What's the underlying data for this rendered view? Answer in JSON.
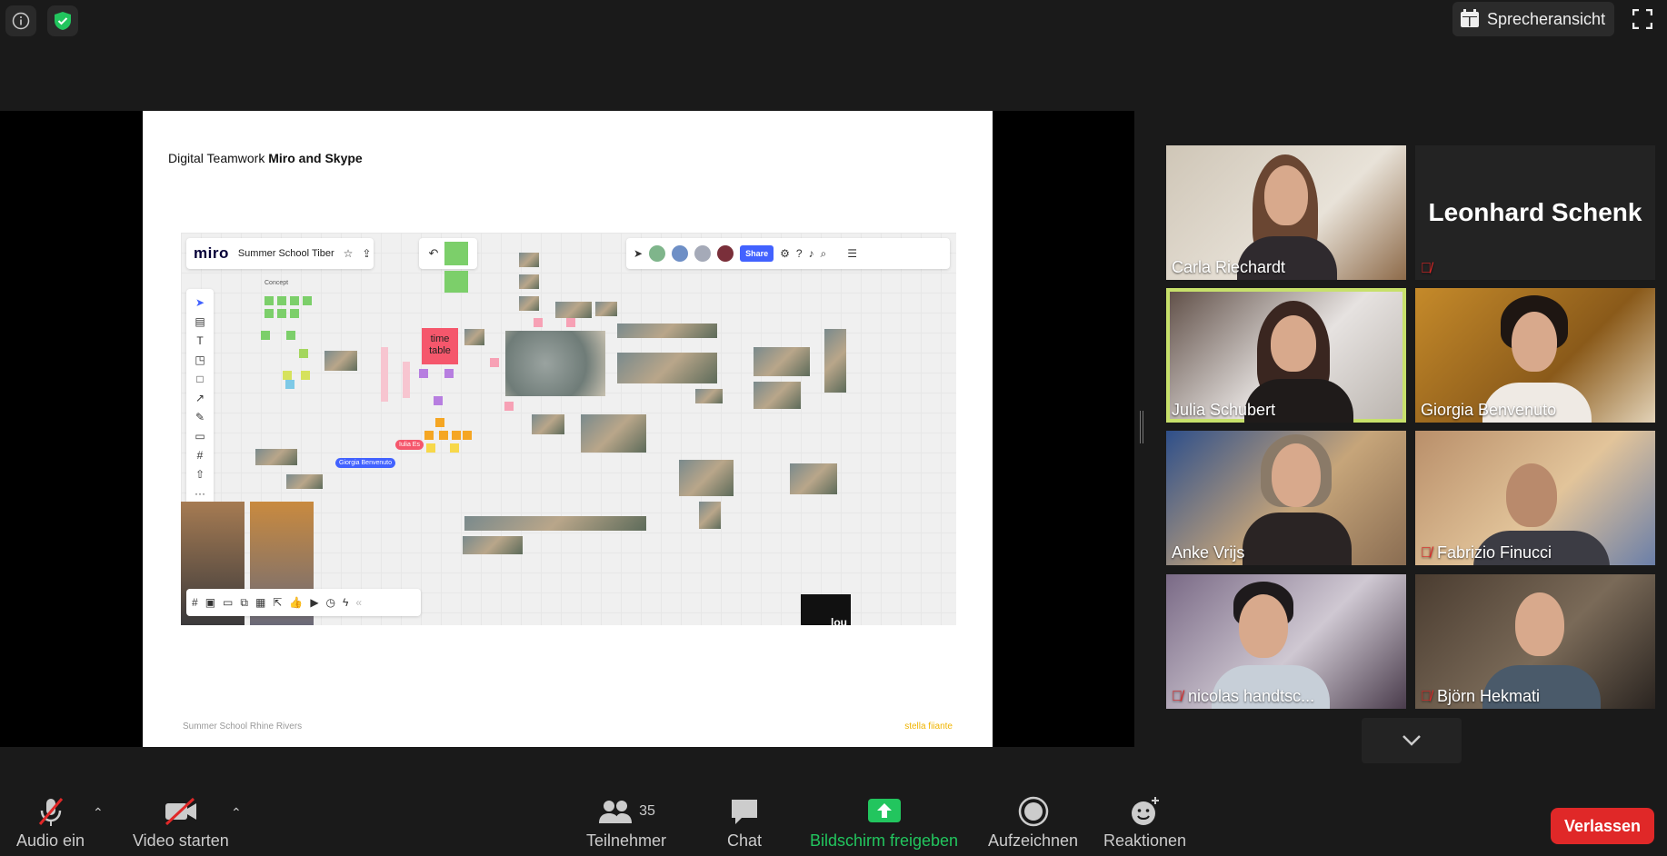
{
  "top": {
    "speaker_view_label": "Sprecheransicht"
  },
  "slide": {
    "title_prefix": "Digital Teamwork",
    "title_bold": "Miro and Skype",
    "footer_left": "Summer School Rhine Rivers",
    "footer_right": "stella fiiante"
  },
  "miro": {
    "logo": "miro",
    "board_name": "Summer School Tiber",
    "share_label": "Share",
    "concept_label": "Concept",
    "timetable_label": "time table",
    "cursor_giorgia": "Giorgia Benvenuto",
    "cursor_julia": "Iulia Es",
    "corner_label": "lou"
  },
  "participants": [
    {
      "name": "Carla Riechardt",
      "muted": false
    },
    {
      "name": "Leonhard Schenk",
      "muted": true
    },
    {
      "name": "Julia Schubert",
      "muted": false,
      "active": true
    },
    {
      "name": "Giorgia Benvenuto",
      "muted": false
    },
    {
      "name": "Anke Vrijs",
      "muted": false
    },
    {
      "name": "Fabrizio Finucci",
      "muted": true
    },
    {
      "name": "nicolas handtsc...",
      "muted": true
    },
    {
      "name": "Björn Hekmati",
      "muted": true
    }
  ],
  "toolbar": {
    "audio_label": "Audio ein",
    "video_label": "Video starten",
    "participants_label": "Teilnehmer",
    "participants_count": "35",
    "chat_label": "Chat",
    "share_label": "Bildschirm freigeben",
    "record_label": "Aufzeichnen",
    "reactions_label": "Reaktionen",
    "leave_label": "Verlassen"
  },
  "colors": {
    "share_green": "#22c55e",
    "leave_red": "#e02828",
    "active_speaker": "#c7e06b",
    "miro_blue": "#4262ff"
  }
}
